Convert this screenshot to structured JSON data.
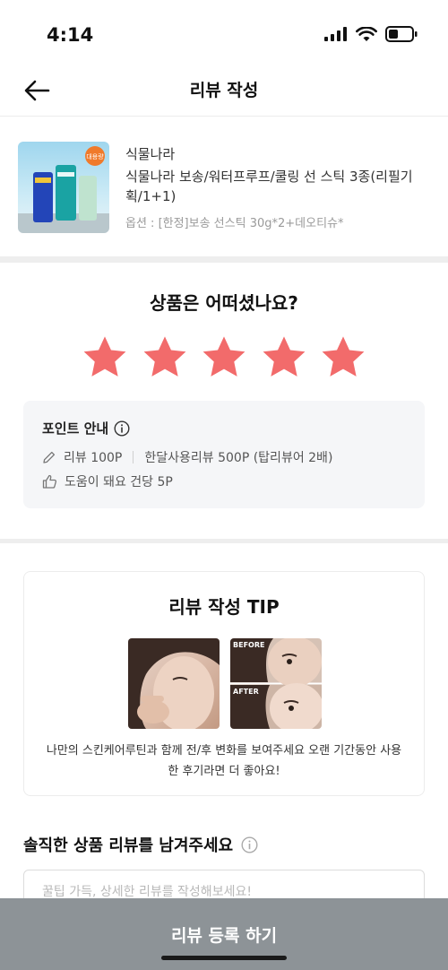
{
  "status": {
    "time": "4:14"
  },
  "nav": {
    "title": "리뷰 작성"
  },
  "product": {
    "badge": "대용량",
    "brand": "식물나라",
    "name": "식물나라 보송/워터프루프/쿨링 선 스틱 3종(리필기획/1+1)",
    "option": "옵션 : [한정]보송 선스틱 30g*2+데오티슈*"
  },
  "rating": {
    "question": "상품은 어떠셨나요?",
    "stars": 5,
    "max": 5,
    "star_color": "#f26b6b"
  },
  "points": {
    "title": "포인트 안내",
    "line1_a": "리뷰 100P",
    "line1_b": "한달사용리뷰 500P (탑리뷰어 2배)",
    "line2": "도움이 돼요 건당 5P"
  },
  "tip": {
    "title": "리뷰 작성 TIP",
    "before_label": "BEFORE",
    "after_label": "AFTER",
    "desc": "나만의 스킨케어루틴과 함께 전/후 변화를 보여주세요 오랜 기간동안 사용한 후기라면 더 좋아요!"
  },
  "review": {
    "label": "솔직한 상품 리뷰를 남겨주세요",
    "placeholder": "꿀팁 가득, 상세한 리뷰를 작성해보세요!"
  },
  "submit": {
    "label": "리뷰 등록 하기",
    "color": "#8d9397"
  }
}
